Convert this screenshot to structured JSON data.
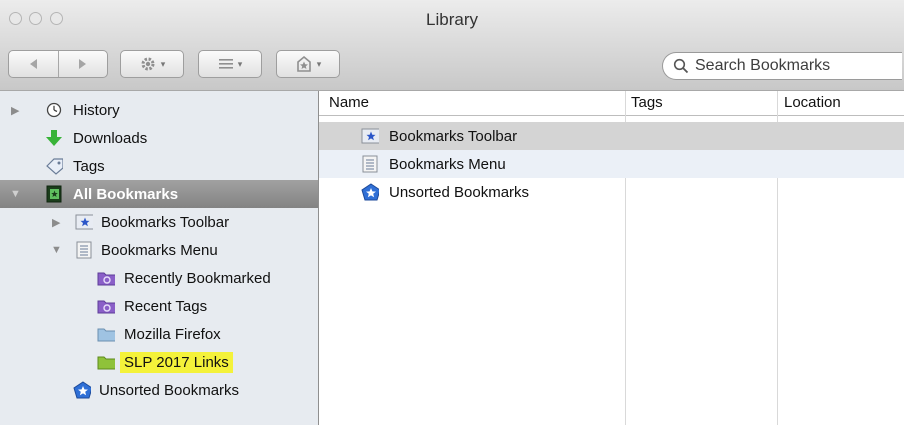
{
  "window": {
    "title": "Library"
  },
  "search": {
    "placeholder": "Search Bookmarks"
  },
  "sidebar": {
    "items": [
      {
        "label": "History",
        "icon": "clock-icon"
      },
      {
        "label": "Downloads",
        "icon": "download-arrow-icon"
      },
      {
        "label": "Tags",
        "icon": "tag-icon"
      },
      {
        "label": "All Bookmarks",
        "icon": "bookmarks-book-icon",
        "selected": true
      },
      {
        "label": "Bookmarks Toolbar",
        "icon": "bookmarks-toolbar-icon"
      },
      {
        "label": "Bookmarks Menu",
        "icon": "bookmarks-menu-icon"
      },
      {
        "label": "Recently Bookmarked",
        "icon": "smart-folder-icon"
      },
      {
        "label": "Recent Tags",
        "icon": "smart-folder-icon"
      },
      {
        "label": "Mozilla Firefox",
        "icon": "folder-icon"
      },
      {
        "label": "SLP 2017 Links",
        "icon": "folder-icon",
        "highlight": "#f4f23a"
      },
      {
        "label": "Unsorted Bookmarks",
        "icon": "unsorted-bookmarks-icon"
      }
    ]
  },
  "main": {
    "columns": [
      "Name",
      "Tags",
      "Location"
    ],
    "rows": [
      {
        "name": "Bookmarks Toolbar",
        "icon": "bookmarks-toolbar-icon"
      },
      {
        "name": "Bookmarks Menu",
        "icon": "bookmarks-menu-icon"
      },
      {
        "name": "Unsorted Bookmarks",
        "icon": "unsorted-bookmarks-icon"
      }
    ]
  },
  "colors": {
    "highlight": "#f4f23a",
    "selected_row": "#8f8f8f",
    "sidebar_bg": "#e7ebf0"
  }
}
